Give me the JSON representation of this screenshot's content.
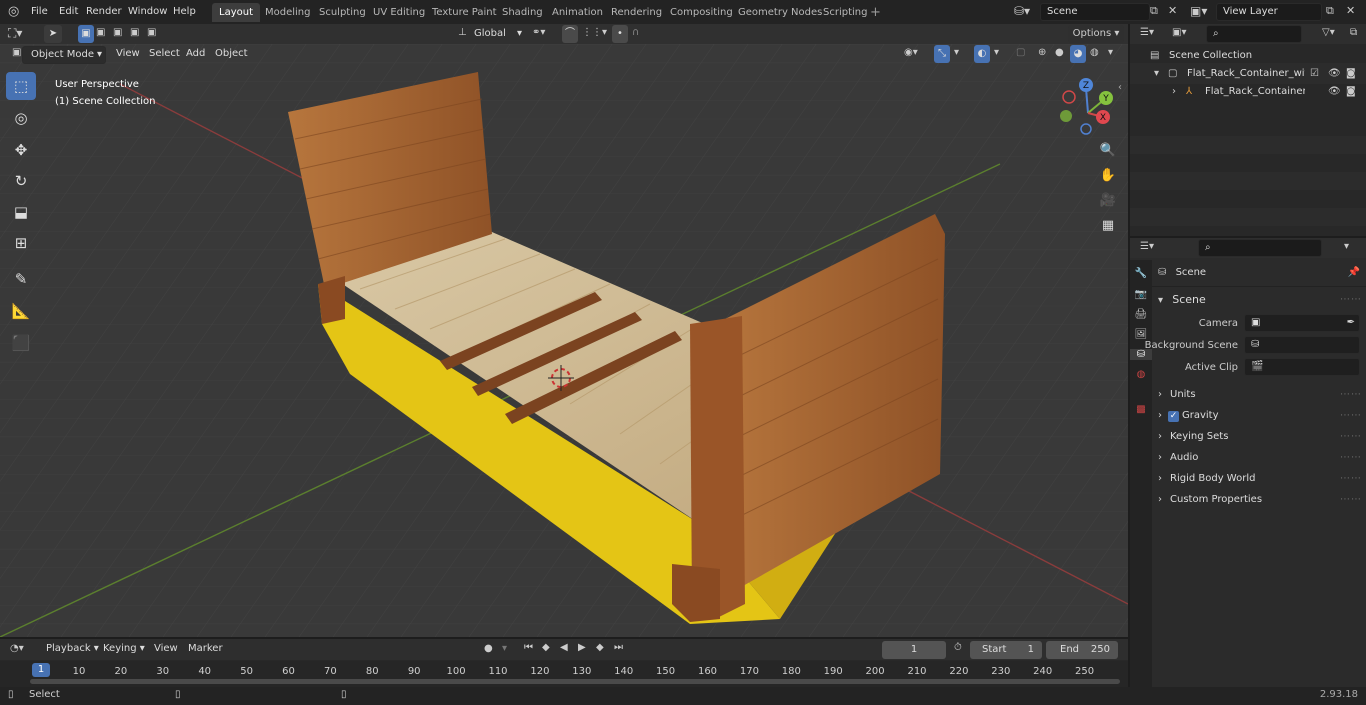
{
  "menus": [
    "File",
    "Edit",
    "Render",
    "Window",
    "Help"
  ],
  "workspaces": [
    "Layout",
    "Modeling",
    "Sculpting",
    "UV Editing",
    "Texture Paint",
    "Shading",
    "Animation",
    "Rendering",
    "Compositing",
    "Geometry Nodes",
    "Scripting"
  ],
  "scene_name": "Scene",
  "view_layer": "View Layer",
  "transform": {
    "orientation": "Global",
    "options": "Options"
  },
  "header3d": {
    "mode": "Object Mode",
    "view": "View",
    "select": "Select",
    "add": "Add",
    "object": "Object"
  },
  "viewport": {
    "perspective": "User Perspective",
    "collection": "(1) Scene Collection"
  },
  "gizmo": {
    "z": "Z",
    "y": "Y",
    "x": "X"
  },
  "outliner": {
    "root": "Scene Collection",
    "items": [
      "Flat_Rack_Container_with_Cc",
      "Flat_Rack_Container_wit"
    ]
  },
  "props": {
    "context": "Scene",
    "panel": "Scene",
    "fields": [
      {
        "label": "Camera"
      },
      {
        "label": "Background Scene"
      },
      {
        "label": "Active Clip"
      }
    ],
    "sections": [
      "Units",
      "Gravity",
      "Keying Sets",
      "Audio",
      "Rigid Body World",
      "Custom Properties"
    ]
  },
  "timeline": {
    "playback": "Playback",
    "keying": "Keying",
    "view": "View",
    "marker": "Marker",
    "frame": "1",
    "start_label": "Start",
    "start": "1",
    "end_label": "End",
    "end": "250",
    "current": "1",
    "ticks": [
      "10",
      "20",
      "30",
      "40",
      "50",
      "60",
      "70",
      "80",
      "90",
      "100",
      "110",
      "120",
      "130",
      "140",
      "150",
      "160",
      "170",
      "180",
      "190",
      "200",
      "210",
      "220",
      "230",
      "240",
      "250"
    ]
  },
  "status": {
    "select": "Select",
    "version": "2.93.18"
  },
  "colors": {
    "accent": "#4772b3",
    "wood": "#a5622e",
    "deck": "#cbb48d",
    "yellow": "#e9cc16"
  }
}
